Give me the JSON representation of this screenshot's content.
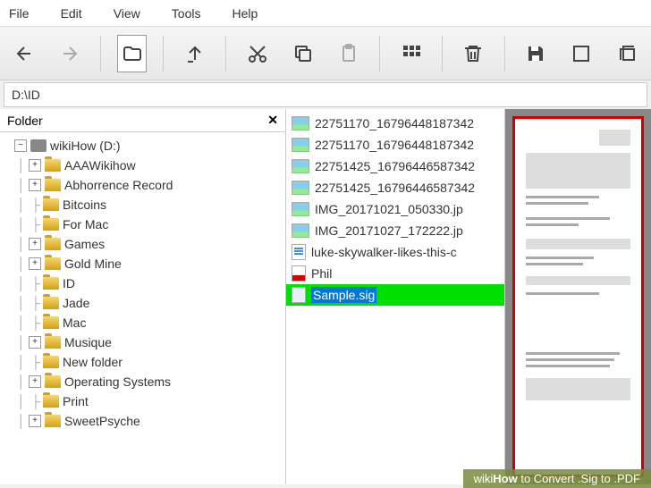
{
  "menu": {
    "file": "File",
    "edit": "Edit",
    "view": "View",
    "tools": "Tools",
    "help": "Help"
  },
  "path": "D:\\ID",
  "folder_panel": {
    "title": "Folder"
  },
  "tree": {
    "root": "wikiHow (D:)",
    "items": [
      "AAAWikihow",
      "Abhorrence Record",
      "Bitcoins",
      "For Mac",
      "Games",
      "Gold Mine",
      "ID",
      "Jade",
      "Mac",
      "Musique",
      "New folder",
      "Operating Systems",
      "Print",
      "SweetPsyche"
    ]
  },
  "files": [
    {
      "name": "22751170_16796448187342",
      "type": "img"
    },
    {
      "name": "22751170_16796448187342",
      "type": "img"
    },
    {
      "name": "22751425_16796446587342",
      "type": "img"
    },
    {
      "name": "22751425_16796446587342",
      "type": "img"
    },
    {
      "name": "IMG_20171021_050330.jp",
      "type": "img"
    },
    {
      "name": "IMG_20171027_172222.jp",
      "type": "img"
    },
    {
      "name": "luke-skywalker-likes-this-c",
      "type": "doc"
    },
    {
      "name": "Phil",
      "type": "pdf"
    },
    {
      "name": "Sample.sig",
      "type": "txt",
      "selected": true
    }
  ],
  "watermark": {
    "prefix": "wiki",
    "mid": "How",
    "suffix": " to Convert .Sig to .PDF"
  }
}
